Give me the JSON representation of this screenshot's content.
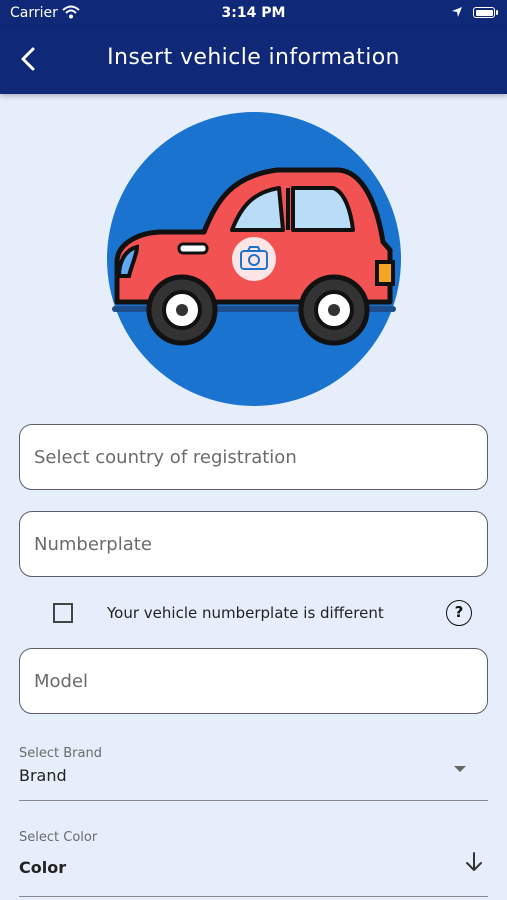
{
  "status_bar": {
    "carrier": "Carrier",
    "time": "3:14 PM",
    "icons": [
      "wifi-icon",
      "location-icon",
      "battery-icon"
    ]
  },
  "header": {
    "back_icon": "chevron-left-icon",
    "title": "Insert vehicle information"
  },
  "photo": {
    "illustration": "red-car-illustration",
    "overlay_icon": "camera-icon",
    "background_color": "#1A73CE"
  },
  "form": {
    "country": {
      "placeholder": "Select country of registration",
      "value": ""
    },
    "numberplate": {
      "placeholder": "Numberplate",
      "value": ""
    },
    "different_plate": {
      "label": "Your vehicle numberplate is different",
      "checked": false,
      "help_icon": "question-circle-icon"
    },
    "model": {
      "placeholder": "Model",
      "value": ""
    },
    "brand": {
      "label": "Select Brand",
      "value": "Brand",
      "icon": "caret-down-icon"
    },
    "color": {
      "label": "Select Color",
      "value": "Color",
      "icon": "arrow-down-icon"
    }
  },
  "colors": {
    "header_bg": "#0F2878",
    "page_bg": "#E6EEFB",
    "car_body": "#F25252"
  }
}
